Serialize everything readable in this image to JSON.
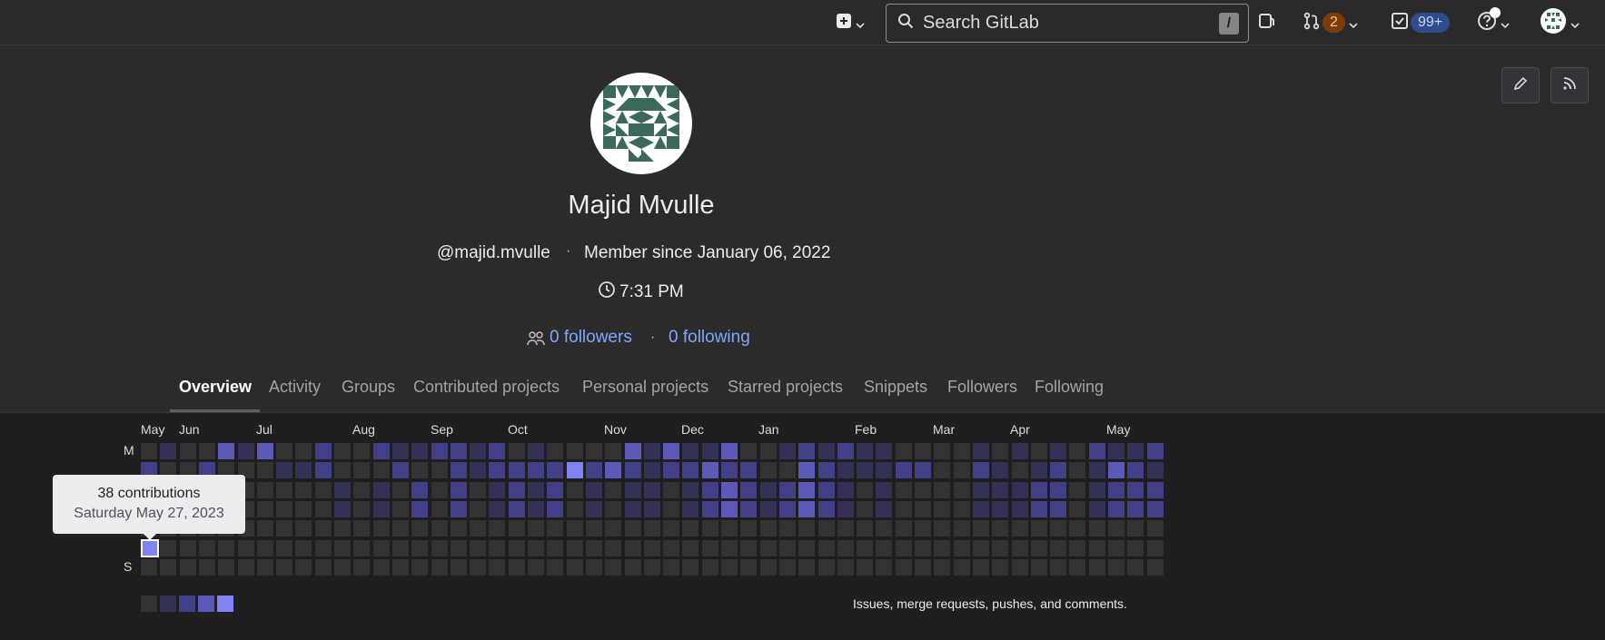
{
  "navbar": {
    "search_placeholder": "Search GitLab",
    "search_shortcut": "/",
    "merge_requests_count": "2",
    "todos_count": "99+",
    "icons": [
      "plus-square-icon",
      "search-icon",
      "issues-icon",
      "merge-request-icon",
      "todo-icon",
      "help-icon",
      "avatar-icon"
    ]
  },
  "profile": {
    "name": "Majid Mvulle",
    "username": "@majid.mvulle",
    "member_since": "Member since January 06, 2022",
    "local_time": "7:31 PM",
    "followers": "0 followers",
    "following": "0 following",
    "icons": [
      "pencil-icon",
      "rss-icon",
      "clock-icon",
      "users-icon"
    ]
  },
  "tabs": [
    {
      "label": "Overview",
      "active": true
    },
    {
      "label": "Activity"
    },
    {
      "label": "Groups"
    },
    {
      "label": "Contributed projects"
    },
    {
      "label": "Personal projects"
    },
    {
      "label": "Starred projects"
    },
    {
      "label": "Snippets"
    },
    {
      "label": "Followers"
    },
    {
      "label": "Following"
    }
  ],
  "calendar": {
    "months": [
      "May",
      "Jun",
      "Jul",
      "Aug",
      "Sep",
      "Oct",
      "Nov",
      "Dec",
      "Jan",
      "Feb",
      "Mar",
      "Apr",
      "May"
    ],
    "day_labels": [
      "M",
      "S"
    ],
    "legend_text": "Issues, merge requests, pushes, and comments.",
    "tooltip": {
      "contributions": "38 contributions",
      "date": "Saturday May 27, 2023"
    },
    "level_colors": [
      "#333333",
      "#333256",
      "#414087",
      "#5c5ab8",
      "#8382f2"
    ],
    "levels": [
      "0100313002002112212010000313113001212110000101010211222323111111111111111111111111111110101",
      "2002000112000200212222423212232200321112200210120132131212122212122222111111111111111111111",
      "0002300000101020201212010110123212321010000111220122201222012212122102000000000000000000000",
      "0000000000101020201212010110123212321010000111220122201222012212122102000000000000000000000",
      "0000000000000000000000000000000000000000000000000000000000000000000000000000000000000000000",
      "0000000000000000000000000000000000000000000000000000000000000000000000000000000000000000000",
      "0000000000000000000000000000000000000000000000000000000000000000000000000000000000000000000"
    ]
  }
}
